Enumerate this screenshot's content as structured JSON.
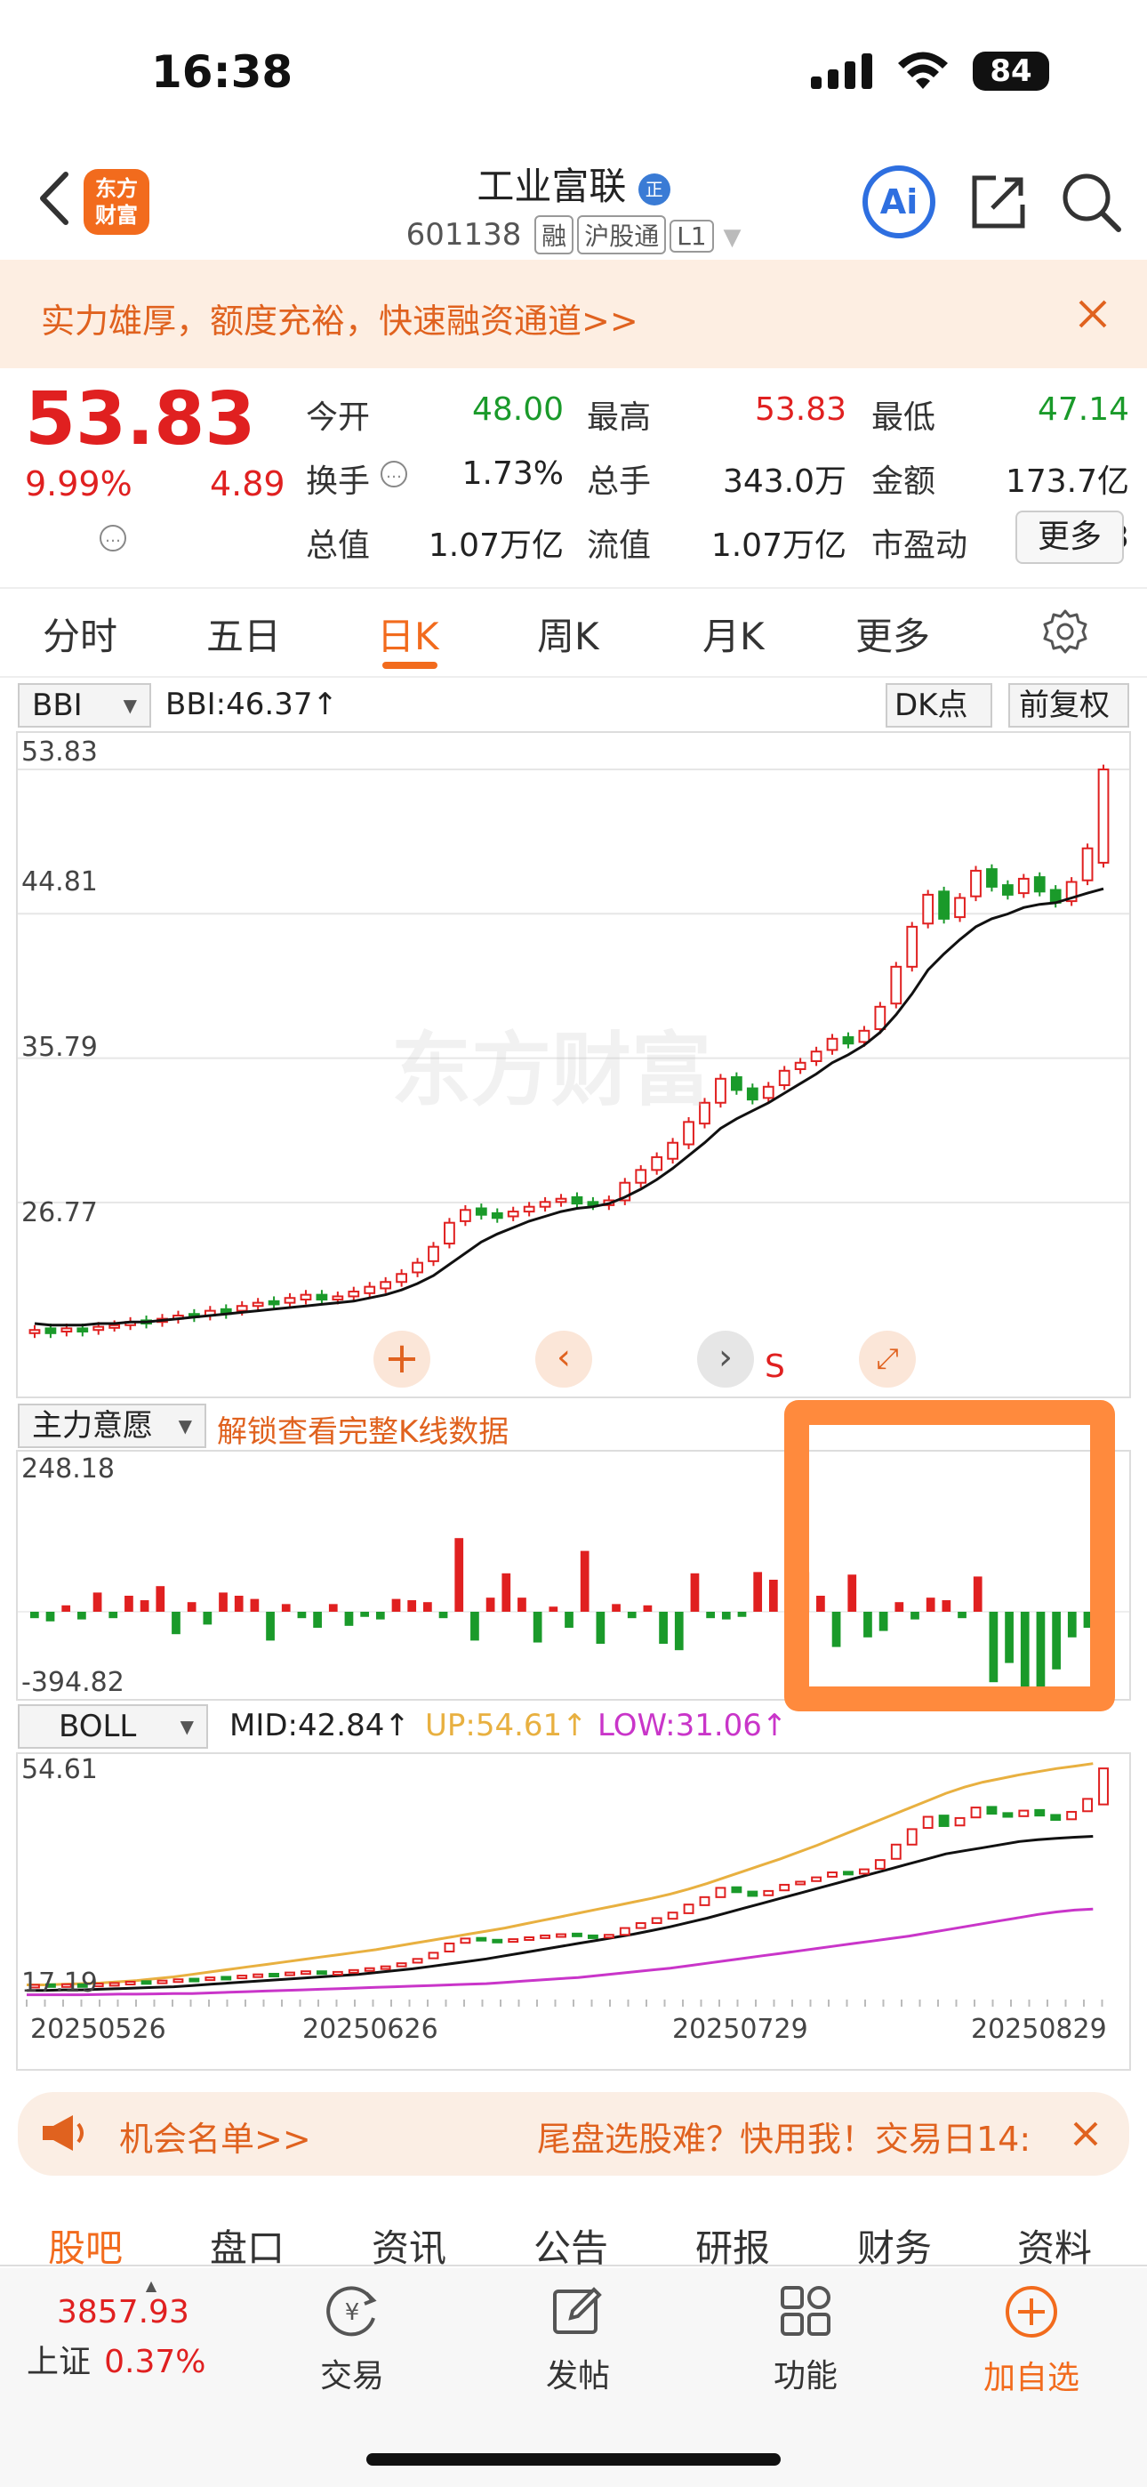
{
  "status_bar": {
    "time": "16:38",
    "battery": "84"
  },
  "header": {
    "logo_text": "东方财富",
    "stock_name": "工业富联",
    "name_badge": "正",
    "stock_code": "601138",
    "tags": [
      "融",
      "沪股通",
      "L1"
    ]
  },
  "banner": {
    "text": "实力雄厚，额度充裕，快速融资通道>>"
  },
  "quote": {
    "price": "53.83",
    "pct_change": "9.99%",
    "change": "4.89",
    "rows": [
      [
        {
          "label": "今开",
          "value": "48.00",
          "color": "green"
        },
        {
          "label": "最高",
          "value": "53.83",
          "color": "red"
        },
        {
          "label": "最低",
          "value": "47.14",
          "color": "green"
        }
      ],
      [
        {
          "label": "换手",
          "value": "1.73%",
          "color": "black"
        },
        {
          "label": "总手",
          "value": "343.0万",
          "color": "black"
        },
        {
          "label": "金额",
          "value": "173.7亿",
          "color": "black"
        }
      ],
      [
        {
          "label": "总值",
          "value": "1.07万亿",
          "color": "black"
        },
        {
          "label": "流值",
          "value": "1.07万亿",
          "color": "black"
        },
        {
          "label": "市盈动",
          "value": "44.13",
          "color": "black"
        }
      ]
    ],
    "more_label": "更多"
  },
  "tabs": [
    "分时",
    "五日",
    "日K",
    "周K",
    "月K",
    "更多"
  ],
  "active_tab": "日K",
  "main_chart": {
    "indicator_select": "BBI",
    "indicator_value": "BBI:46.37↑",
    "dk_label": "DK点",
    "adjust_label": "前复权",
    "y_labels": [
      "53.83",
      "44.81",
      "35.79",
      "26.77"
    ],
    "watermark": "东方财富",
    "signal_s": "S",
    "colors": {
      "up": "#e02020",
      "down": "#1a9a2a",
      "line": "#111111",
      "label_bg": "#fbd3b4",
      "label_text": "#e0621f",
      "nine_bg": "#3aa55a"
    }
  },
  "sub_chart": {
    "indicator_select": "主力意愿",
    "unlock_text": "解锁查看完整K线数据",
    "y_max": "248.18",
    "y_min": "-394.82",
    "highlight_color": "#ff8a3d"
  },
  "boll_chart": {
    "indicator_select": "BOLL",
    "mid": "MID:42.84↑",
    "up": "UP:54.61↑",
    "low": "LOW:31.06↑",
    "y_top": "54.61",
    "y_bottom": "17.19",
    "dates": [
      "20250526",
      "20250626",
      "20250729",
      "20250829"
    ],
    "colors": {
      "mid": "#111111",
      "up": "#e8b040",
      "low": "#c935c9"
    }
  },
  "chart_data": {
    "type": "candlestick",
    "y_axis": {
      "max": 53.83,
      "min": 17.19,
      "ticks": [
        53.83,
        44.81,
        35.79,
        26.77
      ]
    },
    "x_labels": [
      "20250526",
      "20250626",
      "20250729",
      "20250829"
    ],
    "closes": [
      18.8,
      18.6,
      18.9,
      18.7,
      19.0,
      19.1,
      19.3,
      19.2,
      19.5,
      19.7,
      19.6,
      20.0,
      19.8,
      20.3,
      20.5,
      20.4,
      20.8,
      21.0,
      20.7,
      20.9,
      21.2,
      21.5,
      21.8,
      22.3,
      23.0,
      24.0,
      25.5,
      26.3,
      26.0,
      25.8,
      26.2,
      26.5,
      26.8,
      27.0,
      26.7,
      26.6,
      26.9,
      28.0,
      28.8,
      29.6,
      30.5,
      31.8,
      33.0,
      34.5,
      33.8,
      33.2,
      34.0,
      35.0,
      35.5,
      36.2,
      37.0,
      36.7,
      37.5,
      39.0,
      41.5,
      44.0,
      46.0,
      44.5,
      45.8,
      47.5,
      46.5,
      46.0,
      47.0,
      46.2,
      45.5,
      46.8,
      48.9,
      53.83
    ],
    "opens": [
      18.6,
      18.9,
      18.7,
      18.9,
      18.8,
      19.0,
      19.1,
      19.4,
      19.3,
      19.5,
      19.8,
      19.7,
      20.1,
      20.0,
      20.3,
      20.6,
      20.5,
      20.7,
      21.0,
      20.7,
      20.9,
      21.1,
      21.4,
      21.8,
      22.4,
      23.1,
      24.2,
      25.6,
      26.4,
      26.1,
      25.9,
      26.2,
      26.5,
      26.8,
      27.1,
      26.8,
      26.6,
      26.9,
      28.0,
      28.8,
      29.5,
      30.4,
      31.7,
      33.0,
      34.6,
      33.9,
      33.3,
      34.1,
      35.1,
      35.6,
      36.3,
      37.1,
      36.8,
      37.6,
      39.2,
      41.5,
      44.2,
      46.2,
      44.6,
      45.9,
      47.6,
      46.6,
      46.1,
      47.1,
      46.3,
      45.6,
      46.9,
      48.0
    ],
    "bbi": [
      19.2,
      19.1,
      19.1,
      19.1,
      19.2,
      19.2,
      19.3,
      19.3,
      19.4,
      19.5,
      19.6,
      19.7,
      19.8,
      19.9,
      20.0,
      20.1,
      20.2,
      20.3,
      20.4,
      20.5,
      20.6,
      20.8,
      21.0,
      21.3,
      21.7,
      22.2,
      22.9,
      23.6,
      24.3,
      24.8,
      25.2,
      25.6,
      25.9,
      26.2,
      26.4,
      26.5,
      26.7,
      27.1,
      27.6,
      28.2,
      28.9,
      29.7,
      30.5,
      31.4,
      32.0,
      32.5,
      33.0,
      33.6,
      34.2,
      34.8,
      35.5,
      36.0,
      36.6,
      37.4,
      38.5,
      39.8,
      41.3,
      42.3,
      43.2,
      44.0,
      44.5,
      44.8,
      45.2,
      45.4,
      45.5,
      45.8,
      46.1,
      46.37
    ],
    "sub_bars": [
      -10,
      -15,
      10,
      -12,
      30,
      -10,
      25,
      18,
      40,
      -35,
      15,
      -20,
      30,
      25,
      20,
      -45,
      12,
      -10,
      -25,
      12,
      -22,
      -8,
      -12,
      20,
      18,
      15,
      -10,
      115,
      -45,
      22,
      60,
      22,
      -48,
      8,
      -25,
      95,
      -50,
      12,
      -10,
      10,
      -50,
      -60,
      60,
      -10,
      -12,
      -8,
      62,
      50,
      72,
      62,
      25,
      -55,
      58,
      -40,
      -30,
      15,
      -12,
      22,
      18,
      -10,
      55,
      -110,
      -80,
      -175,
      -140,
      -90,
      -40,
      -25,
      -10
    ],
    "boll_mid": [
      17.9,
      17.9,
      18.0,
      18.0,
      18.1,
      18.2,
      18.3,
      18.4,
      18.5,
      18.7,
      18.9,
      19.1,
      19.3,
      19.5,
      19.7,
      19.9,
      20.1,
      20.3,
      20.5,
      20.8,
      21.1,
      21.4,
      21.8,
      22.2,
      22.6,
      23.0,
      23.5,
      24.0,
      24.5,
      25.0,
      25.5,
      26.0,
      26.5,
      27.0,
      27.6,
      28.2,
      28.9,
      29.6,
      30.4,
      31.2,
      32.0,
      32.8,
      33.6,
      34.4,
      35.2,
      36.0,
      36.8,
      37.6,
      38.4,
      39.2,
      40.0,
      40.5,
      41.0,
      41.5,
      42.0,
      42.3,
      42.5,
      42.7,
      42.84
    ],
    "boll_up": [
      18.8,
      18.8,
      18.9,
      19.0,
      19.1,
      19.3,
      19.5,
      19.8,
      20.1,
      20.5,
      20.9,
      21.3,
      21.7,
      22.1,
      22.5,
      22.9,
      23.3,
      23.7,
      24.1,
      24.5,
      25.0,
      25.5,
      26.0,
      26.5,
      27.0,
      27.5,
      28.0,
      28.6,
      29.2,
      29.8,
      30.4,
      31.0,
      31.6,
      32.2,
      32.8,
      33.5,
      34.3,
      35.2,
      36.2,
      37.2,
      38.2,
      39.2,
      40.3,
      41.4,
      42.6,
      43.8,
      45.0,
      46.2,
      47.4,
      48.6,
      49.8,
      50.8,
      51.6,
      52.2,
      52.8,
      53.3,
      53.8,
      54.2,
      54.61
    ],
    "boll_low": [
      17.2,
      17.2,
      17.2,
      17.2,
      17.25,
      17.3,
      17.3,
      17.35,
      17.4,
      17.4,
      17.5,
      17.6,
      17.7,
      17.8,
      17.9,
      18.0,
      18.1,
      18.2,
      18.3,
      18.4,
      18.5,
      18.6,
      18.7,
      18.8,
      18.9,
      19.0,
      19.2,
      19.4,
      19.6,
      19.8,
      20.0,
      20.3,
      20.6,
      20.9,
      21.2,
      21.5,
      21.9,
      22.3,
      22.7,
      23.1,
      23.5,
      23.9,
      24.3,
      24.7,
      25.1,
      25.5,
      25.9,
      26.3,
      26.7,
      27.2,
      27.7,
      28.2,
      28.7,
      29.2,
      29.7,
      30.2,
      30.6,
      30.9,
      31.06
    ]
  },
  "opportunity_bar": {
    "left_text": "机会名单>>",
    "right_text": "尾盘选股难？快用我！交易日14:"
  },
  "bottom_tabs": [
    "股吧",
    "盘口",
    "资讯",
    "公告",
    "研报",
    "财务",
    "资料"
  ],
  "active_bottom_tab": "股吧",
  "bottom_nav": {
    "index_value": "3857.93",
    "index_name": "上证",
    "index_pct": "0.37%",
    "items": [
      "交易",
      "发帖",
      "功能",
      "加自选"
    ]
  }
}
